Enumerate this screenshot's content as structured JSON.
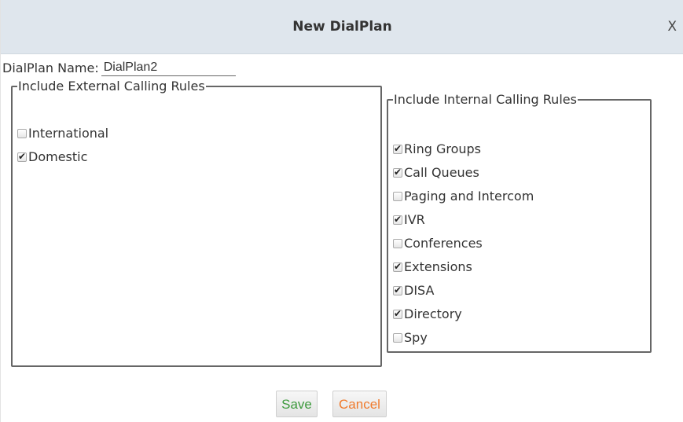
{
  "dialog": {
    "title": "New DialPlan",
    "close_label": "X"
  },
  "name_field": {
    "label": "DialPlan Name:",
    "value": "DialPlan2"
  },
  "external_rules": {
    "legend": "Include External Calling Rules",
    "items": [
      {
        "label": "International",
        "checked": false
      },
      {
        "label": "Domestic",
        "checked": true
      }
    ]
  },
  "internal_rules": {
    "legend": "Include Internal Calling Rules",
    "items": [
      {
        "label": "Ring Groups",
        "checked": true
      },
      {
        "label": "Call Queues",
        "checked": true
      },
      {
        "label": "Paging and Intercom",
        "checked": false
      },
      {
        "label": "IVR",
        "checked": true
      },
      {
        "label": "Conferences",
        "checked": false
      },
      {
        "label": "Extensions",
        "checked": true
      },
      {
        "label": "DISA",
        "checked": true
      },
      {
        "label": "Directory",
        "checked": true
      },
      {
        "label": "Spy",
        "checked": false
      }
    ]
  },
  "buttons": {
    "save_label": "Save",
    "cancel_label": "Cancel"
  },
  "colors": {
    "titlebar_bg": "#dfe6ed",
    "save_text": "#3d9a3d",
    "cancel_text": "#f07a2c"
  }
}
